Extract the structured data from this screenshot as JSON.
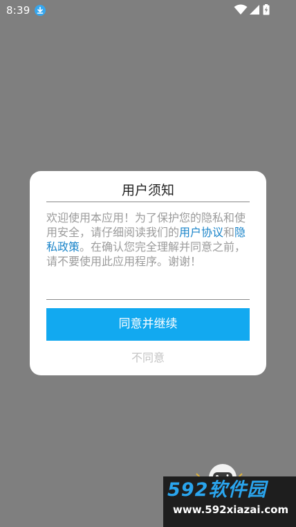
{
  "status_bar": {
    "time": "8:39"
  },
  "dialog": {
    "title": "用户须知",
    "body_before": "欢迎使用本应用！为了保护您的隐私和使用安全，请仔细阅读我们的",
    "link_user_agreement": "用户协议",
    "conjunction": "和",
    "link_privacy_policy": "隐私政策",
    "body_after": "。在确认您完全理解并同意之前，请不要使用此应用程序。谢谢！",
    "agree_label": "同意并继续",
    "disagree_label": "不同意"
  },
  "watermark": {
    "brand": "592软件园",
    "url": "www.592xiazai.com"
  },
  "colors": {
    "backdrop": "#7f7f7f",
    "dialog_background": "#ffffff",
    "primary_button": "#12a9f0",
    "link": "#1a84c9",
    "body_text": "#9b9b9b",
    "disabled_text": "#c3c3c3"
  },
  "icons": {
    "download": "download-icon",
    "wifi": "wifi-icon",
    "signal": "signal-icon",
    "battery": "battery-icon"
  }
}
